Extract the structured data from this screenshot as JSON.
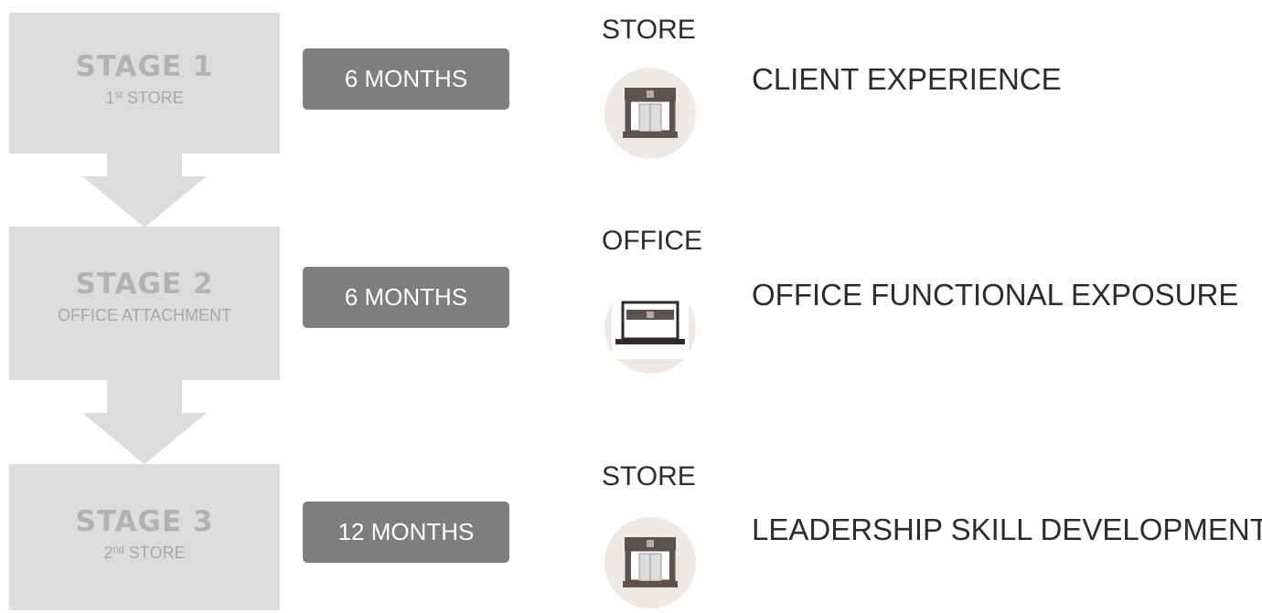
{
  "stages": [
    {
      "title": "STAGE 1",
      "subtitle_main": "1",
      "subtitle_sup": "st",
      "subtitle_rest": " STORE",
      "duration": "6 MONTHS",
      "location": "STORE",
      "location_icon": "store-icon",
      "focus": "CLIENT EXPERIENCE"
    },
    {
      "title": "STAGE 2",
      "subtitle_main": "OFFICE ATTACHMENT",
      "duration": "6 MONTHS",
      "location": "OFFICE",
      "location_icon": "laptop-icon",
      "focus": "OFFICE FUNCTIONAL EXPOSURE"
    },
    {
      "title": "STAGE 3",
      "subtitle_main": "2",
      "subtitle_sup": "nd",
      "subtitle_rest": " STORE",
      "duration": "12 MONTHS",
      "location": "STORE",
      "location_icon": "store-icon",
      "focus": "LEADERSHIP SKILL DEVELOPMENT"
    }
  ],
  "colors": {
    "stage_box": "#dcdcdc",
    "stage_text": "#b2b2b2",
    "duration_bg": "#7f7d7d",
    "duration_text": "#ffffff",
    "label_text": "#2f2b2b",
    "icon_circle": "#efe9e6",
    "icon_dark": "#5e5250"
  }
}
